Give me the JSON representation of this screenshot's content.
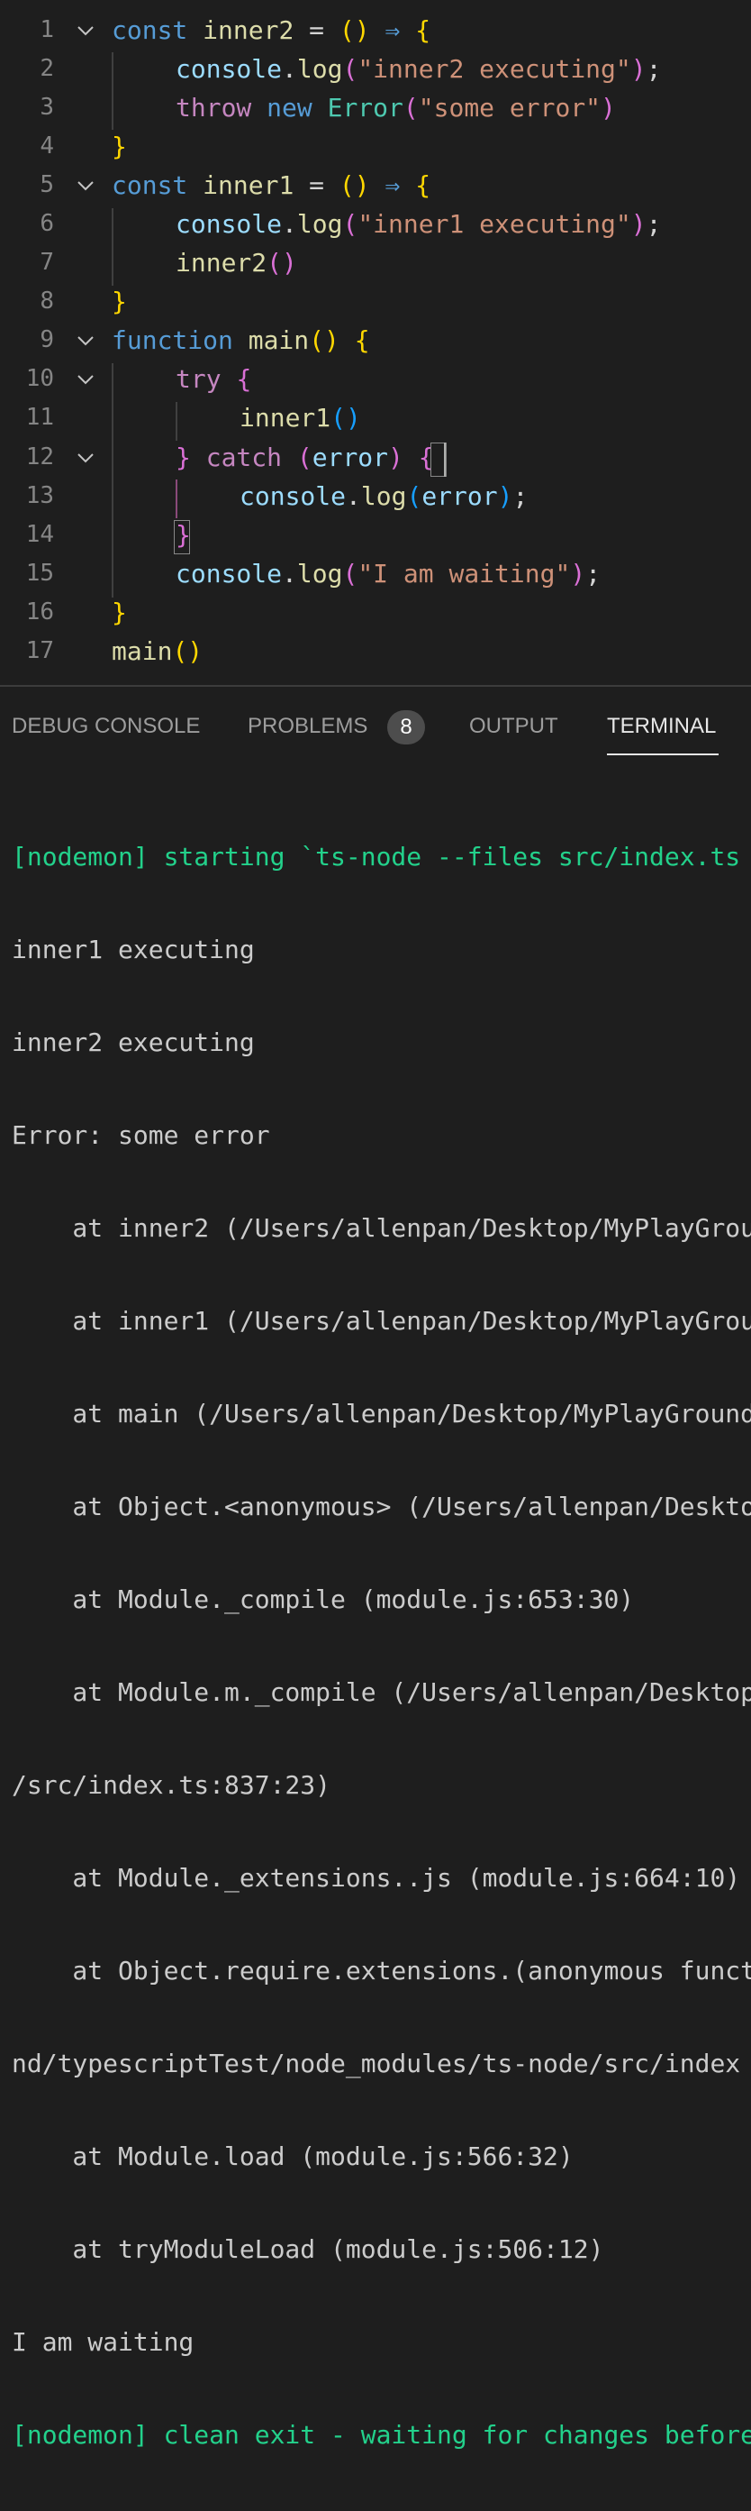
{
  "editor": {
    "lines": [
      {
        "num": "1",
        "tokens": [
          "const",
          "inner2",
          "=",
          "(",
          ")",
          "⇒",
          "{"
        ]
      },
      {
        "num": "2",
        "tokens": [
          "console",
          ".",
          "log",
          "(",
          "\"inner2 executing\"",
          ")",
          ";"
        ]
      },
      {
        "num": "3",
        "tokens": [
          "throw",
          "new",
          "Error",
          "(",
          "\"some error\"",
          ")"
        ]
      },
      {
        "num": "4",
        "tokens": [
          "}"
        ]
      },
      {
        "num": "5",
        "tokens": [
          "const",
          "inner1",
          "=",
          "(",
          ")",
          "⇒",
          "{"
        ]
      },
      {
        "num": "6",
        "tokens": [
          "console",
          ".",
          "log",
          "(",
          "\"inner1 executing\"",
          ")",
          ";"
        ]
      },
      {
        "num": "7",
        "tokens": [
          "inner2",
          "(",
          ")"
        ]
      },
      {
        "num": "8",
        "tokens": [
          "}"
        ]
      },
      {
        "num": "9",
        "tokens": [
          "function",
          "main",
          "(",
          ")",
          "{"
        ]
      },
      {
        "num": "10",
        "tokens": [
          "try",
          "{"
        ]
      },
      {
        "num": "11",
        "tokens": [
          "inner1",
          "(",
          ")"
        ]
      },
      {
        "num": "12",
        "tokens": [
          "}",
          "catch",
          "(",
          "error",
          ")",
          "{"
        ]
      },
      {
        "num": "13",
        "tokens": [
          "console",
          ".",
          "log",
          "(",
          "error",
          ")",
          ";"
        ]
      },
      {
        "num": "14",
        "tokens": [
          "}"
        ]
      },
      {
        "num": "15",
        "tokens": [
          "console",
          ".",
          "log",
          "(",
          "\"I am waiting\"",
          ")",
          ";"
        ]
      },
      {
        "num": "16",
        "tokens": [
          "}"
        ]
      },
      {
        "num": "17",
        "tokens": [
          "main",
          "(",
          ")"
        ]
      }
    ]
  },
  "panel": {
    "tabs": {
      "debug_console": "DEBUG CONSOLE",
      "problems": "PROBLEMS",
      "problems_count": "8",
      "output": "OUTPUT",
      "terminal": "TERMINAL"
    },
    "active_tab": "TERMINAL"
  },
  "terminal": {
    "lines": [
      "[nodemon] starting `ts-node --files src/index.ts",
      "inner1 executing",
      "inner2 executing",
      "Error: some error",
      "    at inner2 (/Users/allenpan/Desktop/MyPlayGrou",
      "    at inner1 (/Users/allenpan/Desktop/MyPlayGrou",
      "    at main (/Users/allenpan/Desktop/MyPlayGround",
      "    at Object.<anonymous> (/Users/allenpan/Deskto",
      "    at Module._compile (module.js:653:30)",
      "    at Module.m._compile (/Users/allenpan/Desktop",
      "/src/index.ts:837:23)",
      "    at Module._extensions..js (module.js:664:10)",
      "    at Object.require.extensions.(anonymous funct",
      "nd/typescriptTest/node_modules/ts-node/src/index",
      "    at Module.load (module.js:566:32)",
      "    at tryModuleLoad (module.js:506:12)",
      "I am waiting",
      "[nodemon] clean exit - waiting for changes before"
    ]
  },
  "colors": {
    "background": "#1e1e1e",
    "keyword": "#569cd6",
    "function": "#dcdcaa",
    "variable": "#9cdcfe",
    "string": "#ce9178",
    "control": "#c586c0",
    "class": "#4ec9b0",
    "nodemon_green": "#23d18b"
  }
}
